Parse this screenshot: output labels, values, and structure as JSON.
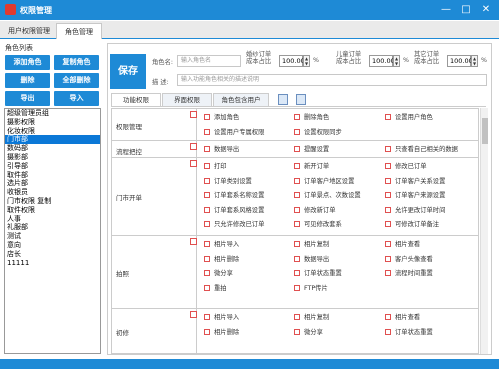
{
  "window": {
    "title": "权限管理",
    "minimize": "—",
    "maximize": "□",
    "close": "✕"
  },
  "tabs": [
    "用户权限管理",
    "角色管理"
  ],
  "left": {
    "header": "角色列表",
    "buttons": [
      "添加角色",
      "复制角色",
      "删除",
      "全部删除",
      "导出",
      "导入"
    ],
    "roles": [
      "超级管理员组",
      "摄影权限",
      "化妆权限",
      "门市部",
      "数码部",
      "摄影部",
      "引导部",
      "取件部",
      "选片部",
      "收银员",
      "门市权限 复制",
      "取件权限",
      "人事",
      "礼服部",
      "测试",
      "意向",
      "店长",
      "11111"
    ],
    "selected_role": "门市部"
  },
  "form": {
    "save_label": "保存",
    "role_name_label": "角色名:",
    "role_name_placeholder": "输入角色名",
    "desc_label": "描  述:",
    "desc_placeholder": "输入功能角色相关的描述说明",
    "ratios": [
      {
        "label": "婚纱订单成本占比",
        "value": "100.00"
      },
      {
        "label": "儿童订单成本占比",
        "value": "100.00"
      },
      {
        "label": "其它订单成本占比",
        "value": "100.00"
      }
    ],
    "percent": "%"
  },
  "perm_tabs": [
    "功能权限",
    "界面权限",
    "角色包含用户"
  ],
  "perm_icons": [
    "select-all-icon",
    "clear-all-icon"
  ],
  "sections": [
    {
      "name": "权限管理",
      "items": [
        "添加角色",
        "删除角色",
        "设置用户角色",
        "设置用户专属权限",
        "设置权限同步"
      ]
    },
    {
      "name": "流程把控",
      "items": [
        "数据导出",
        "提醒设置",
        "只查看自己相关的数据"
      ]
    },
    {
      "name": "门市开单",
      "items": [
        "打印",
        "新开订单",
        "修改已订单",
        "订单类别设置",
        "订单客户地区设置",
        "订单客户关系设置",
        "订单套系名称设置",
        "订单景点、次数设置",
        "订单客户来源设置",
        "订单套系风格设置",
        "修改新订单",
        "允许更改订单时间",
        "只允许修改已订单",
        "可见修改套系",
        "可修改订单备注"
      ]
    },
    {
      "name": "拍照",
      "items": [
        "相片导入",
        "相片复制",
        "相片查看",
        "相片删除",
        "数据导出",
        "客户头像查看",
        "微分享",
        "订单状态重置",
        "流程时间重置",
        "重拍",
        "FTP传片"
      ]
    },
    {
      "name": "初修",
      "items": [
        "相片导入",
        "相片复制",
        "相片查看",
        "相片删除",
        "微分享",
        "订单状态重置"
      ]
    }
  ]
}
